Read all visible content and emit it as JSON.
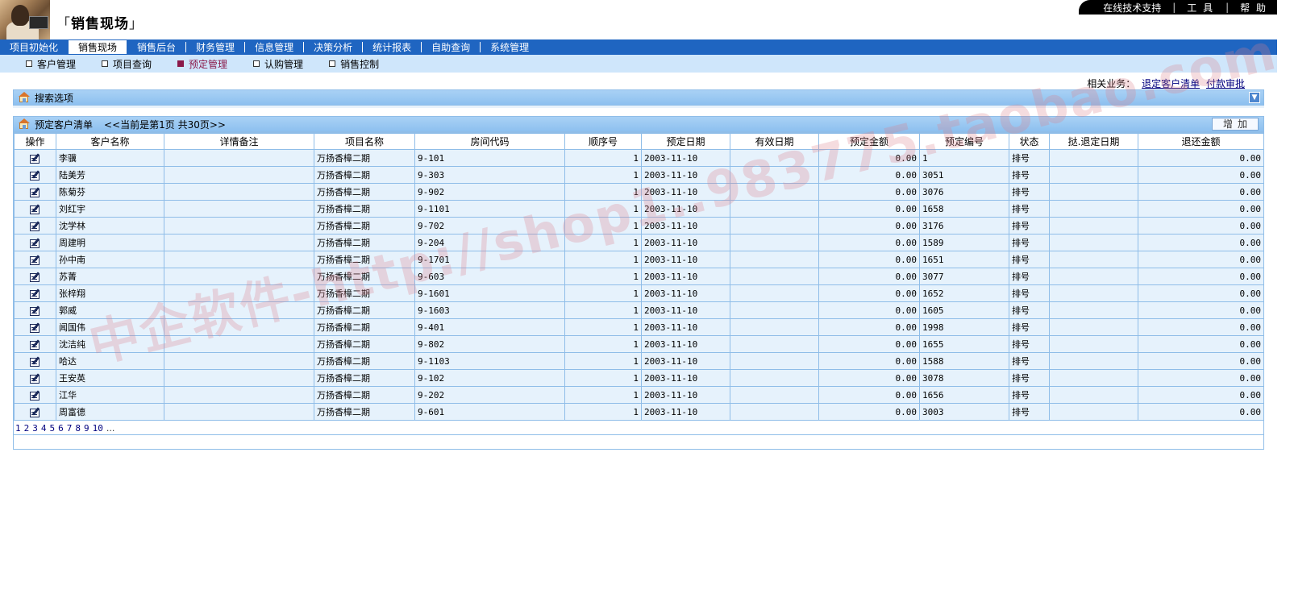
{
  "app": {
    "title": "销售现场",
    "bracket_open": "「",
    "bracket_close": "」"
  },
  "top_links": {
    "support": "在线技术支持",
    "tools": "工 具",
    "help": "帮 助",
    "sep": "|"
  },
  "main_nav": [
    {
      "label": "项目初始化"
    },
    {
      "label": "销售现场",
      "active": true
    },
    {
      "label": "销售后台"
    },
    {
      "label": "财务管理"
    },
    {
      "label": "信息管理"
    },
    {
      "label": "决策分析"
    },
    {
      "label": "统计报表"
    },
    {
      "label": "自助查询"
    },
    {
      "label": "系统管理"
    }
  ],
  "sub_nav": [
    {
      "label": "客户管理"
    },
    {
      "label": "项目查询"
    },
    {
      "label": "预定管理",
      "active": true
    },
    {
      "label": "认购管理"
    },
    {
      "label": "销售控制"
    }
  ],
  "related": {
    "label": "相关业务：",
    "link1": "退定客户清单",
    "link2": "付款审批"
  },
  "search_panel": {
    "title": "搜索选项",
    "collapse_icon": "▼"
  },
  "list_panel": {
    "title": "预定客户清单",
    "pager_info": "<<当前是第1页  共30页>>",
    "add_button": "增加"
  },
  "table": {
    "columns": [
      "操作",
      "客户名称",
      "详情备注",
      "项目名称",
      "房间代码",
      "顺序号",
      "预定日期",
      "有效日期",
      "预定金额",
      "预定编号",
      "状态",
      "挞.退定日期",
      "退还金额"
    ],
    "rows": [
      {
        "name": "李骥",
        "note": "",
        "project": "万扬香樟二期",
        "room": "9-101",
        "seq": "1",
        "date": "2003-11-10",
        "valid": "",
        "amount": "0.00",
        "code": "1",
        "status": "排号",
        "refund_date": "",
        "refund": "0.00"
      },
      {
        "name": "陆美芳",
        "note": "",
        "project": "万扬香樟二期",
        "room": "9-303",
        "seq": "1",
        "date": "2003-11-10",
        "valid": "",
        "amount": "0.00",
        "code": "3051",
        "status": "排号",
        "refund_date": "",
        "refund": "0.00"
      },
      {
        "name": "陈菊芬",
        "note": "",
        "project": "万扬香樟二期",
        "room": "9-902",
        "seq": "1",
        "date": "2003-11-10",
        "valid": "",
        "amount": "0.00",
        "code": "3076",
        "status": "排号",
        "refund_date": "",
        "refund": "0.00"
      },
      {
        "name": "刘红宇",
        "note": "",
        "project": "万扬香樟二期",
        "room": "9-1101",
        "seq": "1",
        "date": "2003-11-10",
        "valid": "",
        "amount": "0.00",
        "code": "1658",
        "status": "排号",
        "refund_date": "",
        "refund": "0.00"
      },
      {
        "name": "沈学林",
        "note": "",
        "project": "万扬香樟二期",
        "room": "9-702",
        "seq": "1",
        "date": "2003-11-10",
        "valid": "",
        "amount": "0.00",
        "code": "3176",
        "status": "排号",
        "refund_date": "",
        "refund": "0.00"
      },
      {
        "name": "周建明",
        "note": "",
        "project": "万扬香樟二期",
        "room": "9-204",
        "seq": "1",
        "date": "2003-11-10",
        "valid": "",
        "amount": "0.00",
        "code": "1589",
        "status": "排号",
        "refund_date": "",
        "refund": "0.00"
      },
      {
        "name": "孙中南",
        "note": "",
        "project": "万扬香樟二期",
        "room": "9-1701",
        "seq": "1",
        "date": "2003-11-10",
        "valid": "",
        "amount": "0.00",
        "code": "1651",
        "status": "排号",
        "refund_date": "",
        "refund": "0.00"
      },
      {
        "name": "苏菁",
        "note": "",
        "project": "万扬香樟二期",
        "room": "9-603",
        "seq": "1",
        "date": "2003-11-10",
        "valid": "",
        "amount": "0.00",
        "code": "3077",
        "status": "排号",
        "refund_date": "",
        "refund": "0.00"
      },
      {
        "name": "张梓翔",
        "note": "",
        "project": "万扬香樟二期",
        "room": "9-1601",
        "seq": "1",
        "date": "2003-11-10",
        "valid": "",
        "amount": "0.00",
        "code": "1652",
        "status": "排号",
        "refund_date": "",
        "refund": "0.00"
      },
      {
        "name": "郭威",
        "note": "",
        "project": "万扬香樟二期",
        "room": "9-1603",
        "seq": "1",
        "date": "2003-11-10",
        "valid": "",
        "amount": "0.00",
        "code": "1605",
        "status": "排号",
        "refund_date": "",
        "refund": "0.00"
      },
      {
        "name": "闻国伟",
        "note": "",
        "project": "万扬香樟二期",
        "room": "9-401",
        "seq": "1",
        "date": "2003-11-10",
        "valid": "",
        "amount": "0.00",
        "code": "1998",
        "status": "排号",
        "refund_date": "",
        "refund": "0.00"
      },
      {
        "name": "沈洁纯",
        "note": "",
        "project": "万扬香樟二期",
        "room": "9-802",
        "seq": "1",
        "date": "2003-11-10",
        "valid": "",
        "amount": "0.00",
        "code": "1655",
        "status": "排号",
        "refund_date": "",
        "refund": "0.00"
      },
      {
        "name": "哈达",
        "note": "",
        "project": "万扬香樟二期",
        "room": "9-1103",
        "seq": "1",
        "date": "2003-11-10",
        "valid": "",
        "amount": "0.00",
        "code": "1588",
        "status": "排号",
        "refund_date": "",
        "refund": "0.00"
      },
      {
        "name": "王安英",
        "note": "",
        "project": "万扬香樟二期",
        "room": "9-102",
        "seq": "1",
        "date": "2003-11-10",
        "valid": "",
        "amount": "0.00",
        "code": "3078",
        "status": "排号",
        "refund_date": "",
        "refund": "0.00"
      },
      {
        "name": "江华",
        "note": "",
        "project": "万扬香樟二期",
        "room": "9-202",
        "seq": "1",
        "date": "2003-11-10",
        "valid": "",
        "amount": "0.00",
        "code": "1656",
        "status": "排号",
        "refund_date": "",
        "refund": "0.00"
      },
      {
        "name": "周富德",
        "note": "",
        "project": "万扬香樟二期",
        "room": "9-601",
        "seq": "1",
        "date": "2003-11-10",
        "valid": "",
        "amount": "0.00",
        "code": "3003",
        "status": "排号",
        "refund_date": "",
        "refund": "0.00"
      }
    ]
  },
  "pagination": {
    "pages": [
      "1",
      "2",
      "3",
      "4",
      "5",
      "6",
      "7",
      "8",
      "9",
      "10"
    ],
    "more": "..."
  },
  "watermark": "中企软件-http://shop1..983775.taobao.com",
  "colors": {
    "nav_blue": "#1f65c1",
    "subnav_bg": "#cfe6fb",
    "panel_bar": "#a9d1f5",
    "cell_bg": "#e6f2fc",
    "active_sub": "#8b1a4a",
    "link": "#00007f"
  },
  "icons": {
    "row_action": "edit-icon",
    "panel": "home-icon",
    "collapse": "collapse-icon"
  }
}
